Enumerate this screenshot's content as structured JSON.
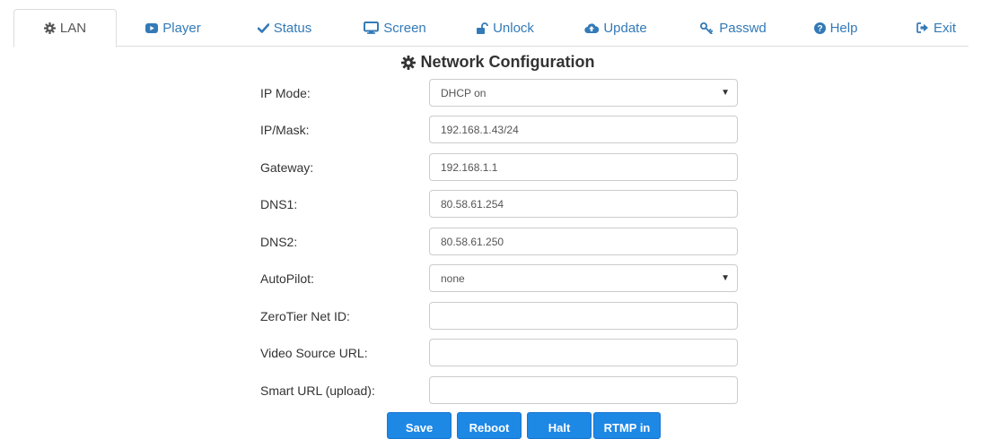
{
  "nav": {
    "tabs": [
      {
        "label": "LAN",
        "icon": "gear-icon",
        "active": true
      },
      {
        "label": "Player",
        "icon": "youtube-play-icon"
      },
      {
        "label": "Status",
        "icon": "checkmark-icon"
      },
      {
        "label": "Screen",
        "icon": "monitor-icon"
      },
      {
        "label": "Unlock",
        "icon": "unlock-icon"
      },
      {
        "label": "Update",
        "icon": "cloud-upload-icon"
      },
      {
        "label": "Passwd",
        "icon": "key-icon"
      },
      {
        "label": "Help",
        "icon": "question-circle-icon"
      },
      {
        "label": "Exit",
        "icon": "sign-out-icon"
      }
    ]
  },
  "page": {
    "title": "Network Configuration",
    "title_icon": "gear-icon"
  },
  "form": {
    "ip_mode": {
      "label": "IP Mode:",
      "value": "DHCP on"
    },
    "ip_mask": {
      "label": "IP/Mask:",
      "value": "192.168.1.43/24"
    },
    "gateway": {
      "label": "Gateway:",
      "value": "192.168.1.1"
    },
    "dns1": {
      "label": "DNS1:",
      "value": "80.58.61.254"
    },
    "dns2": {
      "label": "DNS2:",
      "value": "80.58.61.250"
    },
    "autopilot": {
      "label": "AutoPilot:",
      "value": "none"
    },
    "zerotier": {
      "label": "ZeroTier Net ID:",
      "value": ""
    },
    "video_source": {
      "label": "Video Source URL:",
      "value": ""
    },
    "smart_url": {
      "label": "Smart URL (upload):",
      "value": ""
    }
  },
  "actions": {
    "save": "Save",
    "reboot": "Reboot",
    "halt": "Halt",
    "rtmp": "RTMP in"
  },
  "colors": {
    "link": "#337ab7",
    "button": "#1e88e5",
    "border": "#dddddd"
  }
}
